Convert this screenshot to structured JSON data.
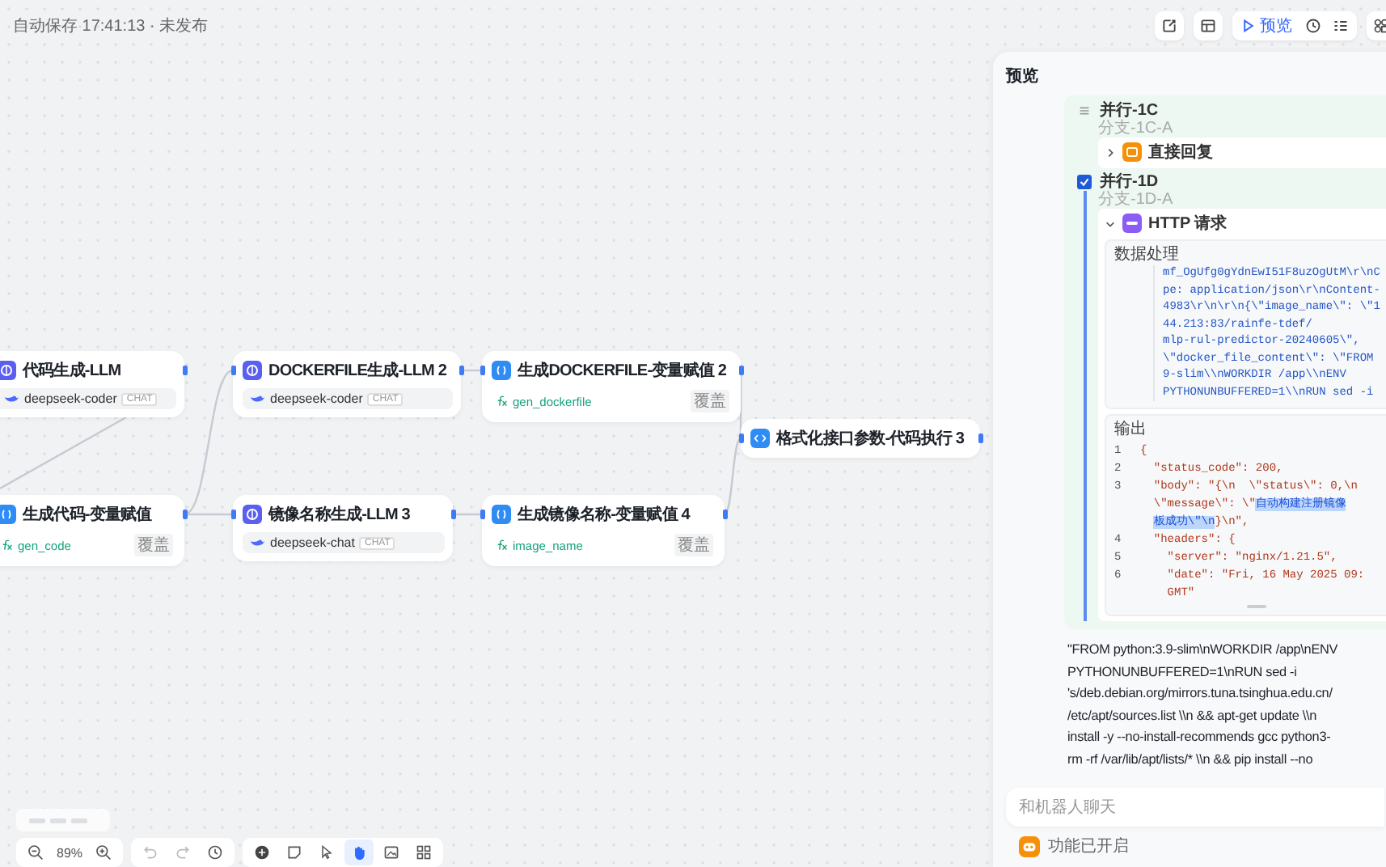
{
  "header": {
    "save_status": "自动保存 17:41:13 · 未发布"
  },
  "toolbar": {
    "preview_label": "预览"
  },
  "nodes": [
    {
      "kind": "llm",
      "title": "代码生成-LLM",
      "model": "deepseek-coder",
      "tag": "CHAT"
    },
    {
      "kind": "llm",
      "title": "DOCKERFILE生成-LLM 2",
      "model": "deepseek-coder",
      "tag": "CHAT"
    },
    {
      "kind": "assign",
      "title": "生成DOCKERFILE-变量赋值 2",
      "variable": "gen_dockerfile",
      "tag": "覆盖"
    },
    {
      "kind": "assign",
      "title": "生成代码-变量赋值",
      "variable": "gen_code",
      "tag": "覆盖"
    },
    {
      "kind": "llm",
      "title": "镜像名称生成-LLM 3",
      "model": "deepseek-chat",
      "tag": "CHAT"
    },
    {
      "kind": "assign",
      "title": "生成镜像名称-变量赋值 4",
      "variable": "image_name",
      "tag": "覆盖"
    },
    {
      "kind": "code",
      "title": "格式化接口参数-代码执行 3"
    }
  ],
  "zoom": {
    "value": "89%"
  },
  "tools": [
    {
      "kind": "add",
      "selected": false
    },
    {
      "kind": "note",
      "selected": false
    },
    {
      "kind": "pointer",
      "selected": false
    },
    {
      "kind": "hand",
      "selected": true
    },
    {
      "kind": "image",
      "selected": false
    },
    {
      "kind": "layout",
      "selected": false
    }
  ],
  "panel": {
    "title": "预览",
    "branches": [
      {
        "label": "并行-1C",
        "sublabel": "分支-1C-A",
        "checked": false,
        "step": {
          "kind": "reply",
          "label": "直接回复",
          "expanded": false
        }
      },
      {
        "label": "并行-1D",
        "sublabel": "分支-1D-A",
        "checked": true,
        "step": {
          "kind": "http",
          "label": "HTTP 请求",
          "expanded": true,
          "input": {
            "label": "数据处理",
            "lines": [
              "mf_OgUfg0gYdnEwI51F8uzOgUtM\\r\\nC",
              "pe: application/json\\r\\nContent-",
              "4983\\r\\n\\r\\n{\\\"image_name\\\": \\\"1",
              "44.213:83/rainfe-tdef/",
              "mlp-rul-predictor-20240605\\\",",
              "\\\"docker_file_content\\\": \\\"FROM",
              "9-slim\\\\nWORKDIR /app\\\\nENV",
              "PYTHONUNBUFFERED=1\\\\nRUN sed -i"
            ]
          },
          "output": {
            "label": "输出",
            "rows": [
              {
                "number": "1",
                "parts": [
                  {
                    "text": "{",
                    "selected": false
                  }
                ]
              },
              {
                "number": "2",
                "parts": [
                  {
                    "text": "  \"status_code\": 200,",
                    "selected": false
                  }
                ]
              },
              {
                "number": "3",
                "parts": [
                  {
                    "text": "  \"body\": \"{\\n  \\\"status\\\": 0,\\n",
                    "selected": false
                  }
                ]
              },
              {
                "parts": [
                  {
                    "text": "\\\"message\\\": \\\"",
                    "selected": false
                  },
                  {
                    "text": "自动构建注册镜像",
                    "selected": true
                  }
                ]
              },
              {
                "parts": [
                  {
                    "text": "板成功\\\"\\n",
                    "selected": true
                  },
                  {
                    "text": "}\\n\",",
                    "selected": false
                  }
                ]
              },
              {
                "number": "4",
                "parts": [
                  {
                    "text": "  \"headers\": {",
                    "selected": false
                  }
                ]
              },
              {
                "number": "5",
                "parts": [
                  {
                    "text": "    \"server\": \"nginx/1.21.5\",",
                    "selected": false
                  }
                ]
              },
              {
                "number": "6",
                "parts": [
                  {
                    "text": "    \"date\": \"Fri, 16 May 2025 09:",
                    "selected": false
                  }
                ]
              },
              {
                "parts": [
                  {
                    "text": "  GMT\"",
                    "selected": false
                  }
                ]
              }
            ]
          }
        }
      }
    ],
    "answer_lines": [
      "\"FROM python:3.9-slim\\nWORKDIR /app\\nENV",
      "PYTHONUNBUFFERED=1\\nRUN sed -i",
      "'s/deb.debian.org/mirrors.tuna.tsinghua.edu.cn/",
      "/etc/apt/sources.list \\\\n && apt-get update \\\\n",
      "install -y --no-install-recommends gcc python3-",
      "rm -rf /var/lib/apt/lists/* \\\\n && pip install --no"
    ],
    "chat": {
      "placeholder": "和机器人聊天"
    },
    "feature_status": "功能已开启"
  }
}
